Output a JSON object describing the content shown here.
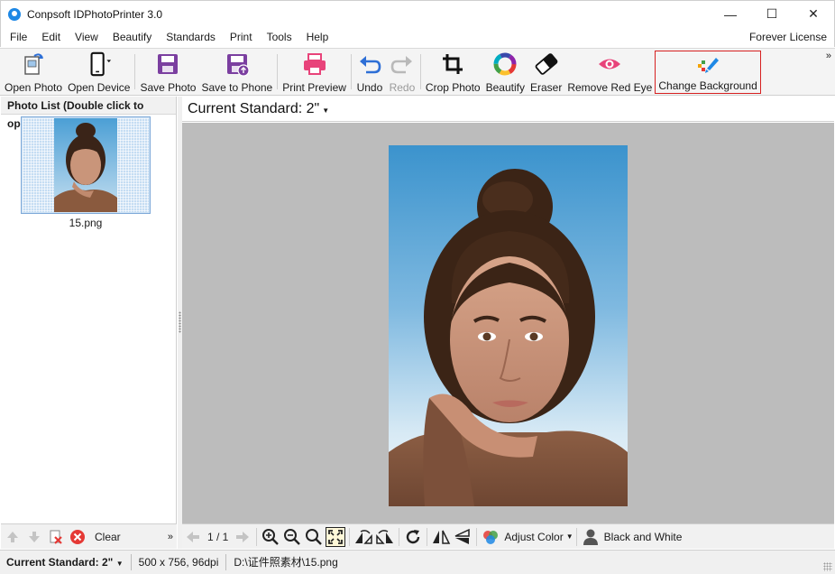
{
  "window": {
    "title": "Conpsoft IDPhotoPrinter 3.0",
    "minimize": "—",
    "maximize": "☐",
    "close": "✕"
  },
  "menu": {
    "items": [
      "File",
      "Edit",
      "View",
      "Beautify",
      "Standards",
      "Print",
      "Tools",
      "Help"
    ],
    "license": "Forever License"
  },
  "toolbar": {
    "open_photo": "Open Photo",
    "open_device": "Open Device",
    "save_photo": "Save Photo",
    "save_to_phone": "Save to Phone",
    "print_preview": "Print Preview",
    "undo": "Undo",
    "redo": "Redo",
    "crop_photo": "Crop Photo",
    "beautify": "Beautify",
    "eraser": "Eraser",
    "remove_red_eye": "Remove Red Eye",
    "change_background": "Change Background",
    "more": "»"
  },
  "photo_list": {
    "header": "Photo List (Double click to open)",
    "items": [
      {
        "name": "15.png"
      }
    ],
    "clear_label": "Clear",
    "more": "»"
  },
  "main": {
    "current_standard": "Current Standard: 2\"",
    "page_indicator": "1 / 1",
    "adjust_color": "Adjust Color",
    "black_and_white": "Black and White"
  },
  "status": {
    "standard": "Current Standard: 2\"",
    "dimensions": "500 x 756, 96dpi",
    "path": "D:\\证件照素材\\15.png"
  },
  "colors": {
    "accent_purple": "#7b3fa0",
    "print_pink": "#e8437a",
    "undo_blue": "#2e6fd6",
    "highlight_red": "#d62020"
  }
}
